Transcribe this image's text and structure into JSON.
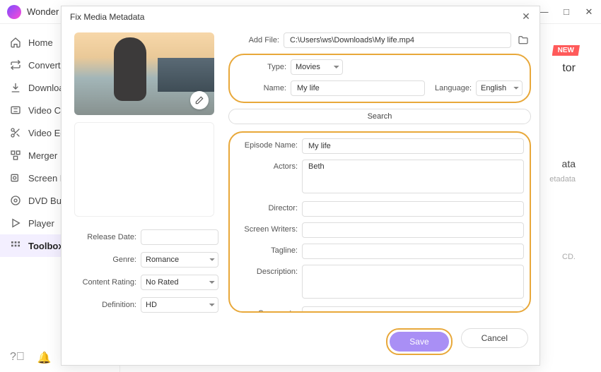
{
  "main": {
    "title": "Wonder"
  },
  "sidebar": {
    "items": [
      {
        "label": "Home"
      },
      {
        "label": "Converter"
      },
      {
        "label": "Downloader"
      },
      {
        "label": "Video Compressor"
      },
      {
        "label": "Video Editor"
      },
      {
        "label": "Merger"
      },
      {
        "label": "Screen Recorder"
      },
      {
        "label": "DVD Burner"
      },
      {
        "label": "Player"
      },
      {
        "label": "Toolbox"
      }
    ]
  },
  "bg": {
    "new": "NEW",
    "title_frag": "tor",
    "sub1": "ata",
    "sub2": "etadata",
    "sub3": "CD."
  },
  "modal": {
    "title": "Fix Media Metadata",
    "addfile": {
      "label": "Add File:",
      "value": "C:\\Users\\ws\\Downloads\\My life.mp4"
    },
    "type": {
      "label": "Type:",
      "value": "Movies"
    },
    "name": {
      "label": "Name:",
      "value": "My life"
    },
    "language": {
      "label": "Language:",
      "value": "English"
    },
    "search": "Search",
    "episode": {
      "label": "Episode Name:",
      "value": "My life"
    },
    "actors": {
      "label": "Actors:",
      "value": "Beth"
    },
    "director": {
      "label": "Director:",
      "value": ""
    },
    "writers": {
      "label": "Screen Writers:",
      "value": ""
    },
    "tagline": {
      "label": "Tagline:",
      "value": ""
    },
    "description": {
      "label": "Description:",
      "value": ""
    },
    "comments": {
      "label": "Comments:",
      "value": ""
    },
    "release": {
      "label": "Release Date:",
      "value": ""
    },
    "genre": {
      "label": "Genre:",
      "value": "Romance"
    },
    "rating": {
      "label": "Content Rating:",
      "value": "No Rated"
    },
    "definition": {
      "label": "Definition:",
      "value": "HD"
    },
    "save": "Save",
    "cancel": "Cancel"
  }
}
